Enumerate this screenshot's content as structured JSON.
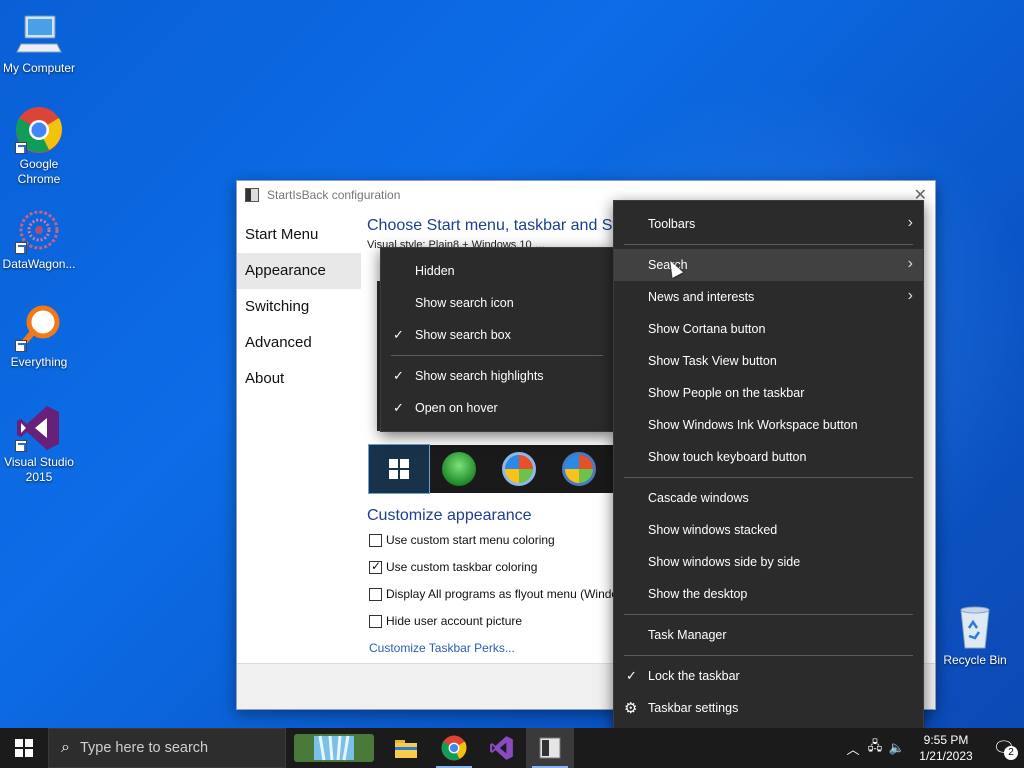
{
  "desktop_icons": [
    {
      "label": "My Computer",
      "icon": "computer-icon"
    },
    {
      "label": "Google Chrome",
      "icon": "chrome-icon"
    },
    {
      "label": "DataWagon...",
      "icon": "datawagon-icon"
    },
    {
      "label": "Everything",
      "icon": "everything-search-icon"
    },
    {
      "label": "Visual Studio 2015",
      "icon": "visual-studio-icon"
    },
    {
      "label": "Recycle Bin",
      "icon": "recycle-bin-icon"
    }
  ],
  "config_window": {
    "title": "StartIsBack configuration",
    "nav": [
      "Start Menu",
      "Appearance",
      "Switching",
      "Advanced",
      "About"
    ],
    "active_nav": "Appearance",
    "heading": "Choose Start menu, taskbar and Sta",
    "subheading": "Visual style: Plain8 + Windows 10 …",
    "customize_title": "Customize appearance",
    "options": [
      {
        "label": "Use custom start menu coloring",
        "checked": false
      },
      {
        "label": "Use custom taskbar coloring",
        "checked": true
      },
      {
        "label": "Display All programs as flyout menu (Windo",
        "checked": false
      },
      {
        "label": "Hide user account picture",
        "checked": false
      }
    ],
    "link": "Customize Taskbar Perks..."
  },
  "taskbar_menu": {
    "items": [
      {
        "label": "Toolbars",
        "submenu": true
      },
      {
        "label": "Search",
        "submenu": true,
        "highlighted": true
      },
      {
        "label": "News and interests",
        "submenu": true
      },
      {
        "label": "Show Cortana button"
      },
      {
        "label": "Show Task View button"
      },
      {
        "label": "Show People on the taskbar"
      },
      {
        "label": "Show Windows Ink Workspace button"
      },
      {
        "label": "Show touch keyboard button"
      },
      {
        "label": "Cascade windows"
      },
      {
        "label": "Show windows stacked"
      },
      {
        "label": "Show windows side by side"
      },
      {
        "label": "Show the desktop"
      },
      {
        "label": "Task Manager"
      },
      {
        "label": "Lock the taskbar",
        "checked": true
      },
      {
        "label": "Taskbar settings",
        "icon": "gear-icon"
      }
    ]
  },
  "search_submenu": {
    "items": [
      {
        "label": "Hidden",
        "checked": false
      },
      {
        "label": "Show search icon",
        "checked": false
      },
      {
        "label": "Show search box",
        "checked": true
      },
      {
        "label": "Show search highlights",
        "checked": true
      },
      {
        "label": "Open on hover",
        "checked": true
      }
    ]
  },
  "taskbar": {
    "search_placeholder": "Type here to search",
    "time": "9:55 PM",
    "date": "1/21/2023",
    "notification_count": "2"
  },
  "colors": {
    "desktop": "#0c6de6",
    "menu_bg": "#2b2b2b",
    "taskbar_bg": "#1b1b1b",
    "heading": "#1e3f8f"
  }
}
